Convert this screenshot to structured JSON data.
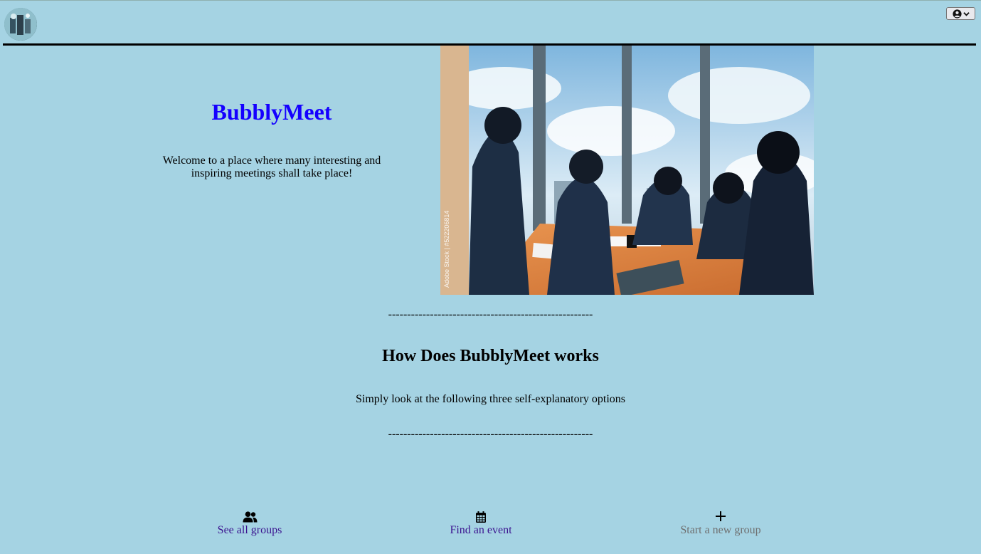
{
  "header": {
    "logo_name": "bubblymeet-logo",
    "profile_button": {
      "icon": "user-circle-icon",
      "caret": "chevron-down-icon"
    }
  },
  "hero": {
    "title": "BubblyMeet",
    "welcome": "Welcome to a place where many interesting and inspiring meetings shall take place!",
    "image_watermark": "Adobe Stock | #522206814"
  },
  "separator_top": "------------------------------------------------------",
  "how": {
    "title": "How Does BubblyMeet works",
    "subtitle": "Simply look at the following three self-explanatory options"
  },
  "separator_bottom": "------------------------------------------------------",
  "options": [
    {
      "label": "See all groups",
      "icon": "users-icon"
    },
    {
      "label": "Find an event",
      "icon": "calendar-icon"
    },
    {
      "label": "Start a new group",
      "icon": "plus-icon"
    }
  ],
  "colors": {
    "background": "#a5d3e3",
    "brand_title": "#1500ff",
    "link_visited": "#3b138f",
    "link_disabled": "#6e6e6e"
  }
}
